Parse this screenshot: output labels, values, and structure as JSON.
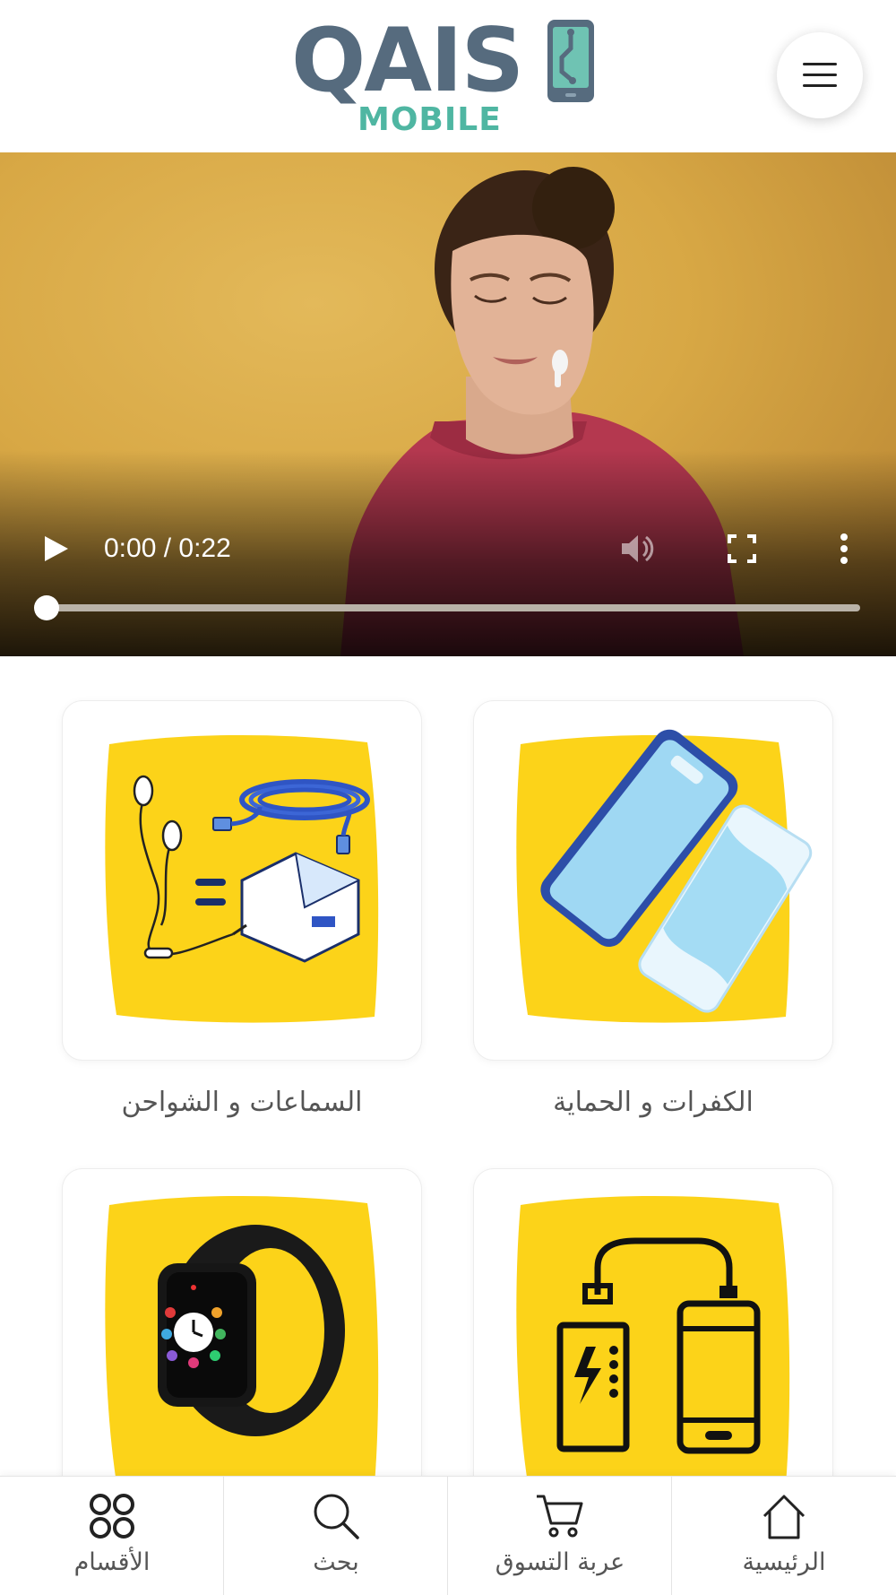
{
  "header": {
    "logo_main": "QAIS",
    "logo_sub": "MOBILE",
    "menu_icon": "hamburger-menu-icon"
  },
  "video": {
    "time_display": "0:00 / 0:22",
    "current_time": "0:00",
    "duration": "0:22",
    "progress": 0,
    "play_icon": "play-icon",
    "volume_icon": "volume-icon",
    "fullscreen_icon": "fullscreen-icon",
    "more_icon": "more-options-icon"
  },
  "categories": [
    {
      "label": "الكفرات و الحماية",
      "icon": "phone-case-protection-icon"
    },
    {
      "label": "السماعات و الشواحن",
      "icon": "earphones-chargers-icon"
    },
    {
      "label": "",
      "icon": "power-bank-icon"
    },
    {
      "label": "",
      "icon": "smartwatch-icon"
    }
  ],
  "bottom_nav": [
    {
      "label": "الرئيسية",
      "icon": "home-icon"
    },
    {
      "label": "عربة التسوق",
      "icon": "cart-icon"
    },
    {
      "label": "بحث",
      "icon": "search-icon"
    },
    {
      "label": "الأقسام",
      "icon": "categories-grid-icon"
    }
  ],
  "colors": {
    "logo_gray": "#566b7e",
    "logo_teal": "#4fb6a2",
    "category_yellow": "#fcd319",
    "video_bg": "#d8a845"
  }
}
